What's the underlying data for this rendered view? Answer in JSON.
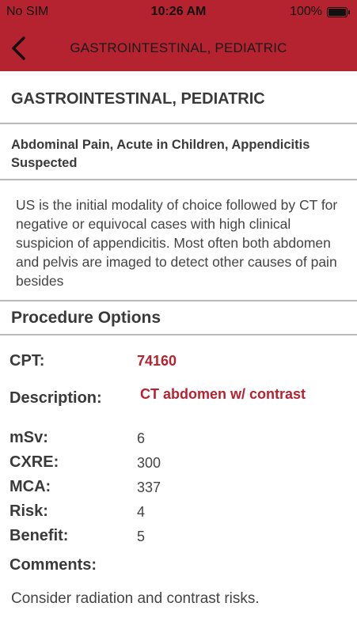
{
  "status_bar": {
    "carrier": "No SIM",
    "time": "10:26 AM",
    "battery": "100%"
  },
  "nav": {
    "title": "GASTROINTESTINAL, PEDIATRIC"
  },
  "heading": "GASTROINTESTINAL, PEDIATRIC",
  "subheading": "Abdominal Pain, Acute in Children, Appendicitis Suspected",
  "description": "US is the initial modality of choice followed by CT for negative or equivocal cases with high clinical suspicion of appendicitis. Most often both abdomen and pelvis are imaged to detect other causes of pain besides",
  "procedure_title": "Procedure Options",
  "fields": {
    "cpt_label": "CPT:",
    "cpt_value": "74160",
    "description_label": "Description:",
    "description_value": "CT abdomen w/ contrast",
    "msv_label": "mSv:",
    "msv_value": "6",
    "cxre_label": "CXRE:",
    "cxre_value": "300",
    "mca_label": "MCA:",
    "mca_value": "337",
    "risk_label": "Risk:",
    "risk_value": "4",
    "benefit_label": "Benefit:",
    "benefit_value": "5",
    "comments_label": "Comments:",
    "comments_value": "Consider radiation and contrast risks."
  },
  "colors": {
    "brand_red": "#b52230",
    "divider": "#b9b9b9",
    "text": "#3a3a3a"
  },
  "icons": {
    "back": "chevron-left-icon",
    "battery": "battery-icon"
  }
}
